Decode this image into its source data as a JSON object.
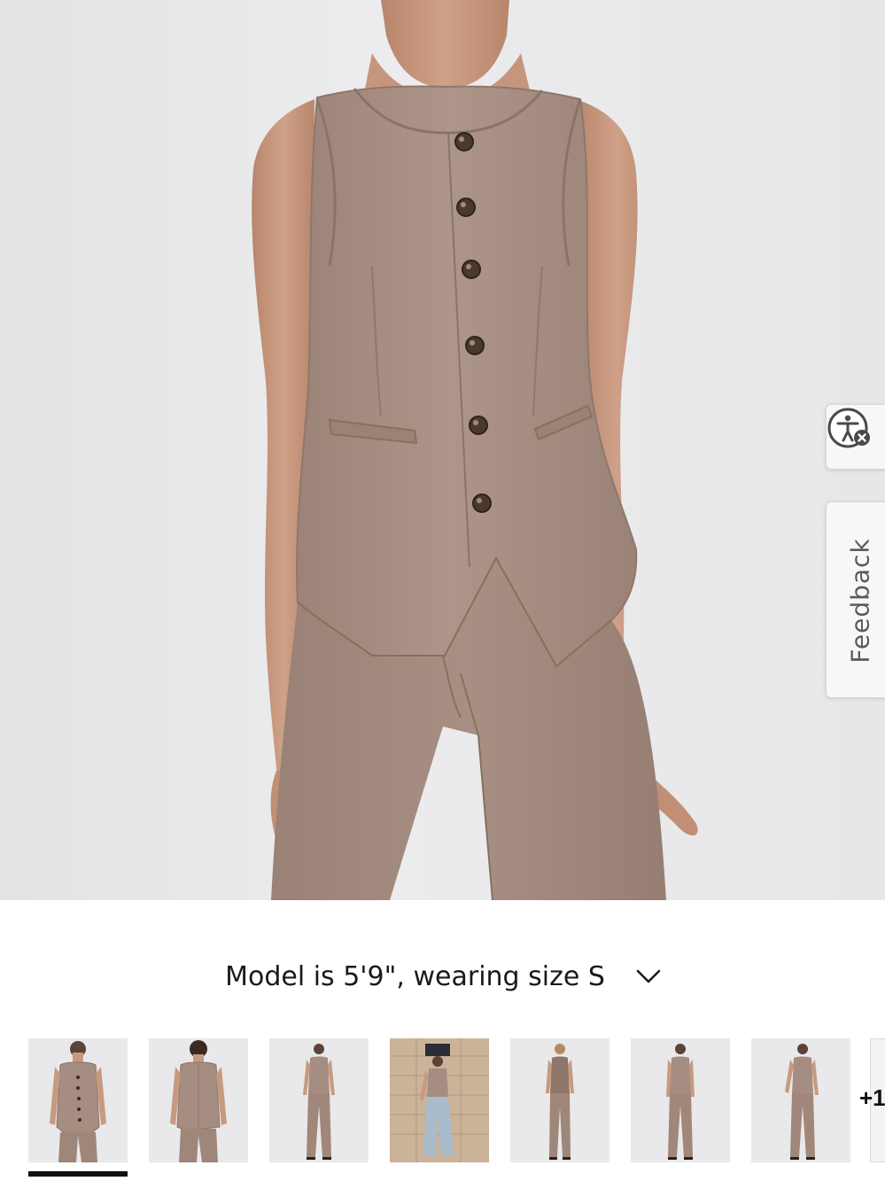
{
  "product": {
    "model_info": "Model is 5'9\", wearing size S",
    "more_images_label": "+1",
    "thumbnails": [
      {
        "view": "front-vest-closeup"
      },
      {
        "view": "back-vest-closeup"
      },
      {
        "view": "full-length-front"
      },
      {
        "view": "street-style-jeans"
      },
      {
        "view": "full-length-front-alt"
      },
      {
        "view": "full-length-front-hands-down"
      },
      {
        "view": "full-length-front-pose"
      }
    ]
  },
  "side_tabs": {
    "accessibility_icon": "accessibility-icon",
    "feedback_label": "Feedback"
  },
  "colors": {
    "garment": "#a58d82",
    "skin": "#c79a80",
    "background": "#e8e7e9",
    "active_indicator": "#111111"
  }
}
